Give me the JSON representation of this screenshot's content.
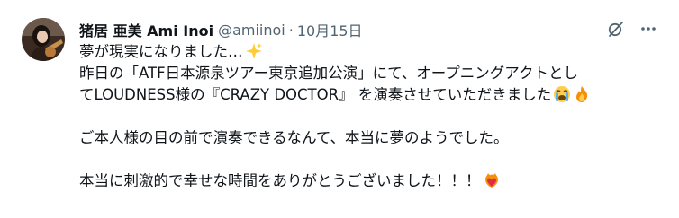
{
  "tweet": {
    "display_name": "猪居 亜美 Ami Inoi",
    "handle": "@amiinoi",
    "separator": "·",
    "time": "10月15日",
    "lines": [
      "夢が現実になりました…",
      "昨日の「ATF日本源泉ツアー東京追加公演」にて、オープニングアクトとし",
      "てLOUDNESS様の『CRAZY DOCTOR』 を演奏させていただきました",
      "",
      "ご本人様の目の前で演奏できるなんて、本当に夢のようでした。",
      "",
      "本当に刺激的で幸せな時間をありがとうございました！！！"
    ],
    "emojis": {
      "line1": "sparkles-emoji",
      "line3a": "crying-face-emoji",
      "line3b": "fire-emoji",
      "line7": "heart-on-fire-emoji"
    }
  },
  "icons": {
    "grok": "grok-icon",
    "more": "more-icon"
  },
  "colors": {
    "text": "#0f1419",
    "secondary": "#536471",
    "background": "#ffffff"
  }
}
